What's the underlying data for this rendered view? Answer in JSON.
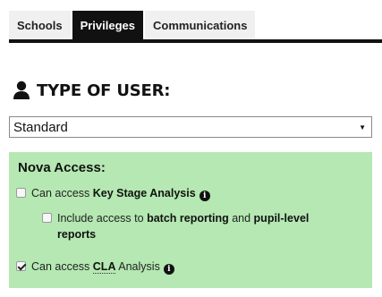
{
  "tabs": [
    {
      "label": "Schools",
      "active": false
    },
    {
      "label": "Privileges",
      "active": true
    },
    {
      "label": "Communications",
      "active": false
    }
  ],
  "section": {
    "title": "TYPE OF USER:",
    "icon": "user-icon"
  },
  "user_type_select": {
    "value": "Standard"
  },
  "nova_access": {
    "heading": "Nova Access:",
    "key_stage": {
      "prefix": "Can access ",
      "bold": "Key Stage Analysis",
      "checked": false,
      "info_icon": "info-icon"
    },
    "batch": {
      "prefix": "Include access to ",
      "bold1": "batch reporting",
      "mid": " and ",
      "bold2": "pupil-level reports",
      "checked": false
    },
    "cla": {
      "prefix": "Can access ",
      "abbr": "CLA",
      "suffix": " Analysis",
      "checked": true,
      "info_icon": "info-icon"
    }
  },
  "colors": {
    "active_tab": "#111111",
    "panel_bg": "#b5e8b2"
  }
}
